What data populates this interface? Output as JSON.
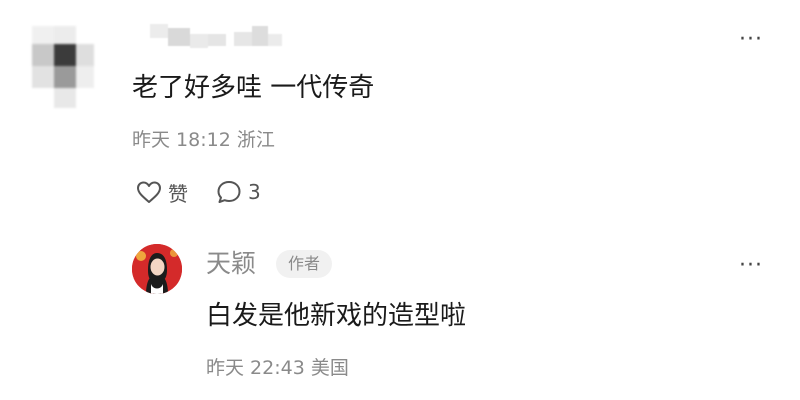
{
  "comments": [
    {
      "text": "老了好多哇 一代传奇",
      "time": "昨天 18:12",
      "location": "浙江",
      "like_label": "赞",
      "reply_count": "3",
      "more_glyph": "···",
      "icons": {
        "like": "heart-outline-icon",
        "reply": "speech-bubble-icon",
        "more": "more-dots-icon"
      }
    }
  ],
  "reply": {
    "username": "天颖",
    "badge": "作者",
    "text": "白发是他新戏的造型啦",
    "time": "昨天 22:43",
    "location": "美国",
    "more_glyph": "···"
  },
  "colors": {
    "text_primary": "#1a1a1a",
    "text_secondary": "#8a8a8a",
    "badge_bg": "#f1f1f1",
    "avatar_red": "#d42a2a"
  }
}
